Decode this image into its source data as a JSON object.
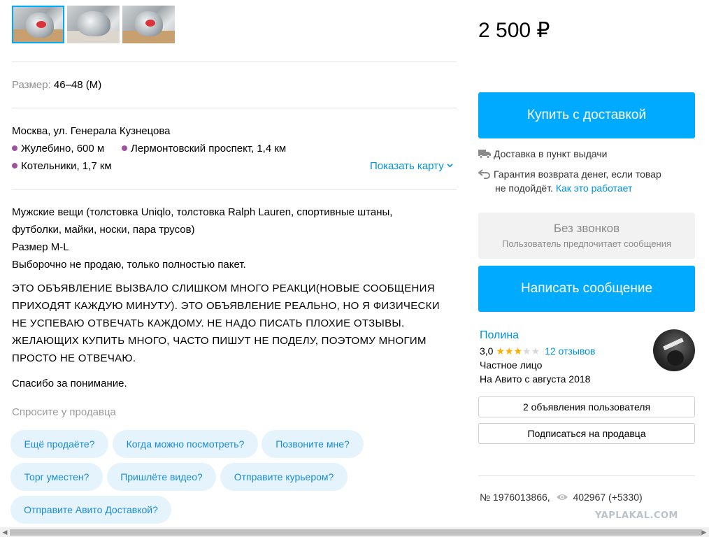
{
  "price": "2 500 ₽",
  "size": {
    "label": "Размер:",
    "value": "46–48 (M)"
  },
  "location": {
    "address": "Москва, ул. Генерала Кузнецова",
    "metro": [
      {
        "name": "Жулебино, 600 м"
      },
      {
        "name": "Лермонтовский проспект, 1,4 км"
      },
      {
        "name": "Котельники, 1,7 км"
      }
    ],
    "show_map": "Показать карту"
  },
  "description": {
    "lines": [
      "Мужские вещи (толстовка Uniqlo, толстовка Ralph Lauren, спортивные штаны,",
      "футболки, майки, носки, пара трусов)",
      "Размер M-L",
      "Выборочно не продаю, только полностью пакет."
    ],
    "caps_lines": [
      "ЭТО ОБЪЯВЛЕНИЕ ВЫЗВАЛО СЛИШКОМ МНОГО РЕАКЦИ(НОВЫЕ СООБЩЕНИЯ",
      "ПРИХОДЯТ КАЖДУЮ МИНУТУ). ЭТО ОБЪЯВЛЕНИЕ РЕАЛЬНО, НО Я ФИЗИЧЕСКИ",
      "НЕ УСПЕВАЮ ОТВЕЧАТЬ КАЖДОМУ. НЕ НАДО ПИСАТЬ ПЛОХИЕ ОТЗЫВЫ.",
      "ЖЕЛАЮЩИХ КУПИТЬ МНОГО, ЧАСТО ПИШУТ НЕ ПОДЕЛУ, ПОЭТОМУ МНОГИМ",
      "ПРОСТО НЕ ОТВЕЧАЮ."
    ],
    "thanks": "Спасибо за понимание."
  },
  "ask_seller": {
    "title": "Спросите у продавца",
    "chips": [
      "Ещё продаёте?",
      "Когда можно посмотреть?",
      "Позвоните мне?",
      "Торг уместен?",
      "Пришлёте видео?",
      "Отправите курьером?",
      "Отправите Авито Доставкой?"
    ]
  },
  "buy_button": "Купить с доставкой",
  "delivery": {
    "pickup": "Доставка в пункт выдачи",
    "guarantee_line1": "Гарантия возврата денег, если товар",
    "guarantee_line2": "не подойдёт.",
    "how_it_works": "Как это работает"
  },
  "no_calls": {
    "title": "Без звонков",
    "subtitle": "Пользователь предпочитает сообщения"
  },
  "message_button": "Написать сообщение",
  "seller": {
    "name": "Полина",
    "rating": "3,0",
    "rating_value": 3,
    "rating_max": 5,
    "reviews": "12 отзывов",
    "type": "Частное лицо",
    "since": "На Авито с августа 2018"
  },
  "user_listings_button": "2 объявления пользователя",
  "subscribe_button": "Подписаться на продавца",
  "stats": {
    "number": "№ 1976013866,",
    "views": "402967 (+5330)"
  },
  "watermark": "YAPLAKAL.COM",
  "colors": {
    "accent": "#00aaff",
    "link": "#0091d9",
    "metro": "#a0529e",
    "star": "#ffae00"
  },
  "icons": [
    "truck-icon",
    "return-arrow-icon",
    "eye-icon",
    "chevron-down-icon",
    "star-icon"
  ]
}
